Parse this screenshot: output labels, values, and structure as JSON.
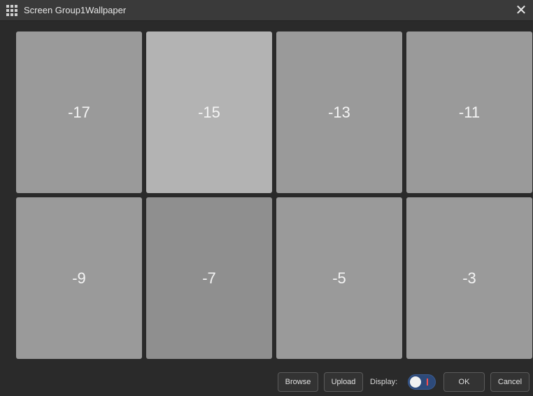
{
  "window": {
    "title": "Screen Group1Wallpaper",
    "close_symbol": "✕"
  },
  "icons": {
    "title_icon": "grid-icon",
    "close_icon": "close-icon"
  },
  "tiles": [
    {
      "label": "-17"
    },
    {
      "label": "-15"
    },
    {
      "label": "-13"
    },
    {
      "label": "-11"
    },
    {
      "label": "-9"
    },
    {
      "label": "-7"
    },
    {
      "label": "-5"
    },
    {
      "label": "-3"
    }
  ],
  "footer": {
    "browse_label": "Browse",
    "upload_label": "Upload",
    "display_label": "Display:",
    "ok_label": "OK",
    "cancel_label": "Cancel"
  },
  "colors": {
    "tile": "#9a9a9a",
    "tile_selected": "#b3b3b3",
    "toggle_bg": "#2d4a7a"
  }
}
